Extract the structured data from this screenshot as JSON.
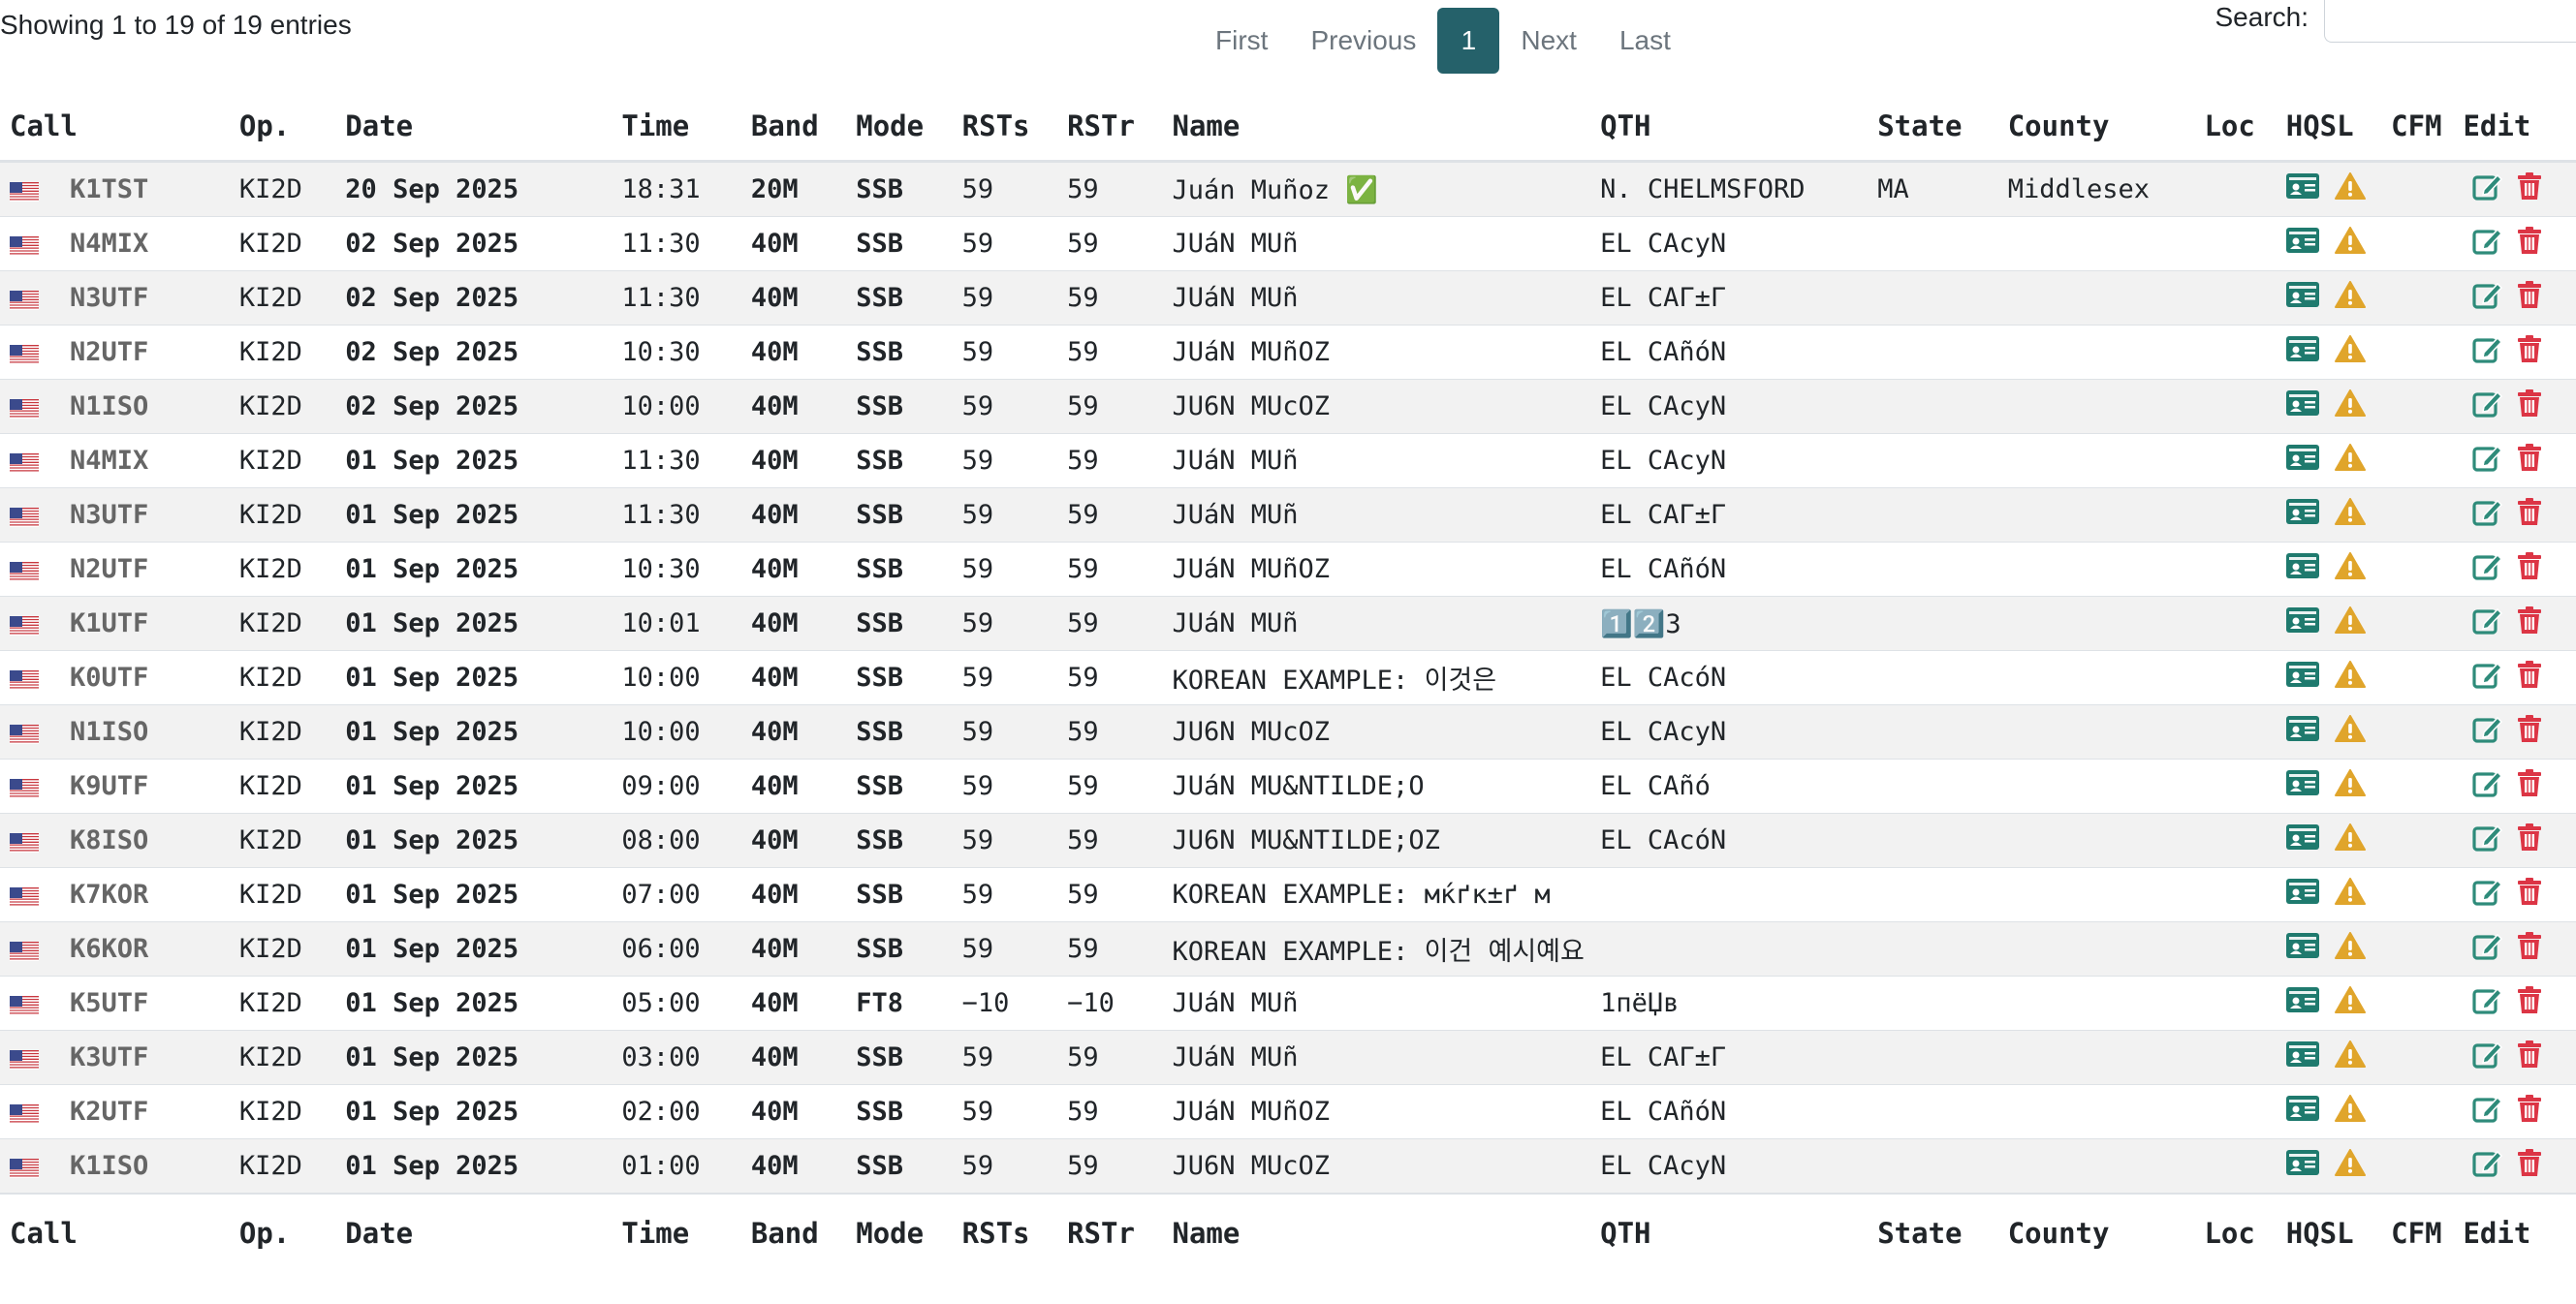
{
  "info": "Showing 1 to 19 of 19 entries",
  "pagination": {
    "first": "First",
    "previous": "Previous",
    "current": "1",
    "next": "Next",
    "last": "Last"
  },
  "search": {
    "label": "Search:",
    "value": ""
  },
  "columns": [
    "Call",
    "Op.",
    "Date",
    "Time",
    "Band",
    "Mode",
    "RSTs",
    "RSTr",
    "Name",
    "QTH",
    "State",
    "County",
    "Loc",
    "HQSL",
    "CFM",
    "Edit"
  ],
  "colors": {
    "accent": "#25616a",
    "hqsl_icon": "#1f7a6e",
    "warn_icon": "#e0a52b",
    "edit_icon": "#2e8b7a",
    "delete_icon": "#dc3545"
  },
  "icons": {
    "flag": "us-flag-icon",
    "hqsl": "id-card-icon",
    "status": "warning-icon",
    "edit": "edit-icon",
    "delete": "trash-icon"
  },
  "rows": [
    {
      "call": "K1TST",
      "op": "KI2D",
      "date": "20 Sep 2025",
      "time": "18:31",
      "band": "20M",
      "mode": "SSB",
      "rsts": "59",
      "rstr": "59",
      "name": "Juán Muñoz ✅",
      "qth": "N. CHELMSFORD",
      "state": "MA",
      "county": "Middlesex",
      "loc": "",
      "cfm": ""
    },
    {
      "call": "N4MIX",
      "op": "KI2D",
      "date": "02 Sep 2025",
      "time": "11:30",
      "band": "40M",
      "mode": "SSB",
      "rsts": "59",
      "rstr": "59",
      "name": "JUáN MUñ",
      "qth": "EL CAcyN",
      "state": "",
      "county": "",
      "loc": "",
      "cfm": ""
    },
    {
      "call": "N3UTF",
      "op": "KI2D",
      "date": "02 Sep 2025",
      "time": "11:30",
      "band": "40M",
      "mode": "SSB",
      "rsts": "59",
      "rstr": "59",
      "name": "JUáN MUñ",
      "qth": "EL CAΓ±Γ",
      "state": "",
      "county": "",
      "loc": "",
      "cfm": ""
    },
    {
      "call": "N2UTF",
      "op": "KI2D",
      "date": "02 Sep 2025",
      "time": "10:30",
      "band": "40M",
      "mode": "SSB",
      "rsts": "59",
      "rstr": "59",
      "name": "JUáN MUñOZ",
      "qth": "EL CAñóN",
      "state": "",
      "county": "",
      "loc": "",
      "cfm": ""
    },
    {
      "call": "N1ISO",
      "op": "KI2D",
      "date": "02 Sep 2025",
      "time": "10:00",
      "band": "40M",
      "mode": "SSB",
      "rsts": "59",
      "rstr": "59",
      "name": "JU6N MUcOZ",
      "qth": "EL CAcyN",
      "state": "",
      "county": "",
      "loc": "",
      "cfm": ""
    },
    {
      "call": "N4MIX",
      "op": "KI2D",
      "date": "01 Sep 2025",
      "time": "11:30",
      "band": "40M",
      "mode": "SSB",
      "rsts": "59",
      "rstr": "59",
      "name": "JUáN MUñ",
      "qth": "EL CAcyN",
      "state": "",
      "county": "",
      "loc": "",
      "cfm": ""
    },
    {
      "call": "N3UTF",
      "op": "KI2D",
      "date": "01 Sep 2025",
      "time": "11:30",
      "band": "40M",
      "mode": "SSB",
      "rsts": "59",
      "rstr": "59",
      "name": "JUáN MUñ",
      "qth": "EL CAΓ±Γ",
      "state": "",
      "county": "",
      "loc": "",
      "cfm": ""
    },
    {
      "call": "N2UTF",
      "op": "KI2D",
      "date": "01 Sep 2025",
      "time": "10:30",
      "band": "40M",
      "mode": "SSB",
      "rsts": "59",
      "rstr": "59",
      "name": "JUáN MUñOZ",
      "qth": "EL CAñóN",
      "state": "",
      "county": "",
      "loc": "",
      "cfm": ""
    },
    {
      "call": "K1UTF",
      "op": "KI2D",
      "date": "01 Sep 2025",
      "time": "10:01",
      "band": "40M",
      "mode": "SSB",
      "rsts": "59",
      "rstr": "59",
      "name": "JUáN MUñ",
      "qth": "1️⃣2️⃣3",
      "state": "",
      "county": "",
      "loc": "",
      "cfm": ""
    },
    {
      "call": "K0UTF",
      "op": "KI2D",
      "date": "01 Sep 2025",
      "time": "10:00",
      "band": "40M",
      "mode": "SSB",
      "rsts": "59",
      "rstr": "59",
      "name": "KOREAN EXAMPLE: 이것은",
      "qth": "EL CAcóN",
      "state": "",
      "county": "",
      "loc": "",
      "cfm": ""
    },
    {
      "call": "N1ISO",
      "op": "KI2D",
      "date": "01 Sep 2025",
      "time": "10:00",
      "band": "40M",
      "mode": "SSB",
      "rsts": "59",
      "rstr": "59",
      "name": "JU6N MUcOZ",
      "qth": "EL CAcyN",
      "state": "",
      "county": "",
      "loc": "",
      "cfm": ""
    },
    {
      "call": "K9UTF",
      "op": "KI2D",
      "date": "01 Sep 2025",
      "time": "09:00",
      "band": "40M",
      "mode": "SSB",
      "rsts": "59",
      "rstr": "59",
      "name": "JUáN MU&NTILDE;O",
      "qth": "EL CAñó",
      "state": "",
      "county": "",
      "loc": "",
      "cfm": ""
    },
    {
      "call": "K8ISO",
      "op": "KI2D",
      "date": "01 Sep 2025",
      "time": "08:00",
      "band": "40M",
      "mode": "SSB",
      "rsts": "59",
      "rstr": "59",
      "name": "JU6N MU&NTILDE;OZ",
      "qth": "EL CAcóN",
      "state": "",
      "county": "",
      "loc": "",
      "cfm": ""
    },
    {
      "call": "K7KOR",
      "op": "KI2D",
      "date": "01 Sep 2025",
      "time": "07:00",
      "band": "40M",
      "mode": "SSB",
      "rsts": "59",
      "rstr": "59",
      "name": "KOREAN EXAMPLE: мќґк±ґ м",
      "qth": "",
      "state": "",
      "county": "",
      "loc": "",
      "cfm": ""
    },
    {
      "call": "K6KOR",
      "op": "KI2D",
      "date": "01 Sep 2025",
      "time": "06:00",
      "band": "40M",
      "mode": "SSB",
      "rsts": "59",
      "rstr": "59",
      "name": "KOREAN EXAMPLE: 이건 예시예요.",
      "qth": "",
      "state": "",
      "county": "",
      "loc": "",
      "cfm": ""
    },
    {
      "call": "K5UTF",
      "op": "KI2D",
      "date": "01 Sep 2025",
      "time": "05:00",
      "band": "40M",
      "mode": "FT8",
      "rsts": "−10",
      "rstr": "−10",
      "name": "JUáN MUñ",
      "qth": "1пёЏв",
      "state": "",
      "county": "",
      "loc": "",
      "cfm": ""
    },
    {
      "call": "K3UTF",
      "op": "KI2D",
      "date": "01 Sep 2025",
      "time": "03:00",
      "band": "40M",
      "mode": "SSB",
      "rsts": "59",
      "rstr": "59",
      "name": "JUáN MUñ",
      "qth": "EL CAΓ±Γ",
      "state": "",
      "county": "",
      "loc": "",
      "cfm": ""
    },
    {
      "call": "K2UTF",
      "op": "KI2D",
      "date": "01 Sep 2025",
      "time": "02:00",
      "band": "40M",
      "mode": "SSB",
      "rsts": "59",
      "rstr": "59",
      "name": "JUáN MUñOZ",
      "qth": "EL CAñóN",
      "state": "",
      "county": "",
      "loc": "",
      "cfm": ""
    },
    {
      "call": "K1ISO",
      "op": "KI2D",
      "date": "01 Sep 2025",
      "time": "01:00",
      "band": "40M",
      "mode": "SSB",
      "rsts": "59",
      "rstr": "59",
      "name": "JU6N MUcOZ",
      "qth": "EL CAcyN",
      "state": "",
      "county": "",
      "loc": "",
      "cfm": ""
    }
  ]
}
